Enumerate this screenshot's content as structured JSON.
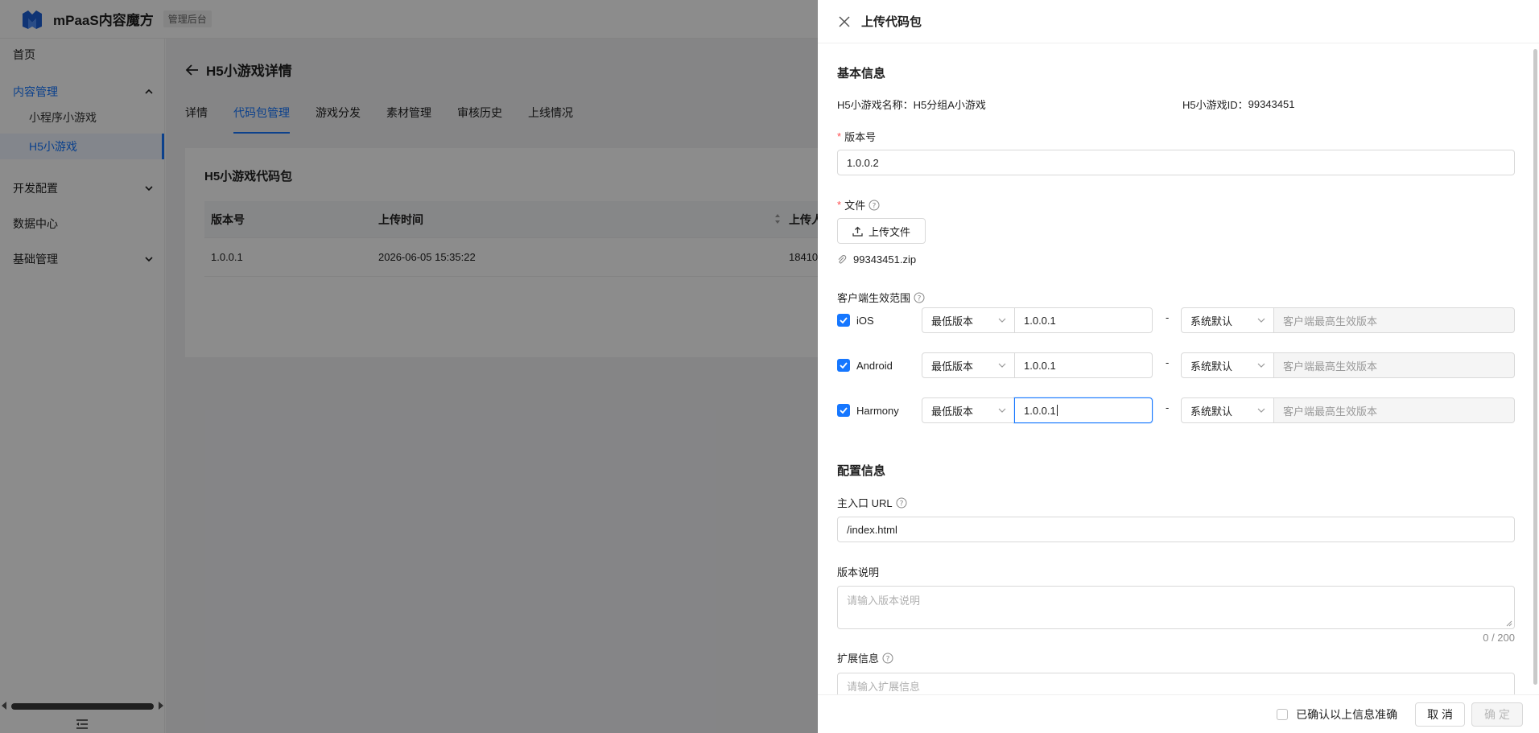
{
  "topbar": {
    "app_title": "mPaaS内容魔方",
    "badge": "管理后台"
  },
  "sidebar": {
    "home": "首页",
    "content_mgmt": "内容管理",
    "mini_program_games": "小程序小游戏",
    "h5_games": "H5小游戏",
    "dev_config": "开发配置",
    "data_center": "数据中心",
    "basic_mgmt": "基础管理"
  },
  "page": {
    "title": "H5小游戏详情",
    "tabs": [
      "详情",
      "代码包管理",
      "游戏分发",
      "素材管理",
      "审核历史",
      "上线情况"
    ],
    "active_tab": "代码包管理",
    "card_title": "H5小游戏代码包",
    "table": {
      "headers": [
        "版本号",
        "上传时间",
        "上传人"
      ],
      "headers_visible": [
        "版本号",
        "上传时间",
        "上传人"
      ],
      "rows": [
        {
          "version": "1.0.0.1",
          "time": "2026-06-05 15:35:22",
          "uploader": "18410"
        }
      ]
    }
  },
  "drawer": {
    "title": "上传代码包",
    "basic_info_title": "基本信息",
    "name_label": "H5小游戏名称：",
    "name_value": "H5分组A小游戏",
    "id_label": "H5小游戏ID：",
    "id_value": "99343451",
    "version_label": "版本号",
    "version_value": "1.0.0.2",
    "file_label": "文件",
    "upload_button": "上传文件",
    "file_name": "99343451.zip",
    "scope_label": "客户端生效范围",
    "platforms": [
      {
        "name": "iOS",
        "checked": true,
        "min_select": "最低版本",
        "min_value": "1.0.0.1",
        "max_select": "系统默认",
        "max_placeholder": "客户端最高生效版本",
        "focused": false
      },
      {
        "name": "Android",
        "checked": true,
        "min_select": "最低版本",
        "min_value": "1.0.0.1",
        "max_select": "系统默认",
        "max_placeholder": "客户端最高生效版本",
        "focused": false
      },
      {
        "name": "Harmony",
        "checked": true,
        "min_select": "最低版本",
        "min_value": "1.0.0.1",
        "max_select": "系统默认",
        "max_placeholder": "客户端最高生效版本",
        "focused": true
      }
    ],
    "range_separator": "-",
    "config_title": "配置信息",
    "entry_url_label": "主入口 URL",
    "entry_url_value": "/index.html",
    "release_notes_label": "版本说明",
    "release_notes_placeholder": "请输入版本说明",
    "release_notes_counter": "0 / 200",
    "ext_info_label": "扩展信息",
    "ext_info_placeholder": "请输入扩展信息",
    "confirm_text": "已确认以上信息准确",
    "cancel_button": "取 消",
    "ok_button": "确 定"
  },
  "colors": {
    "primary": "#1677ff",
    "required": "#ff4d4f",
    "mask": "rgba(0,0,0,0.45)"
  }
}
